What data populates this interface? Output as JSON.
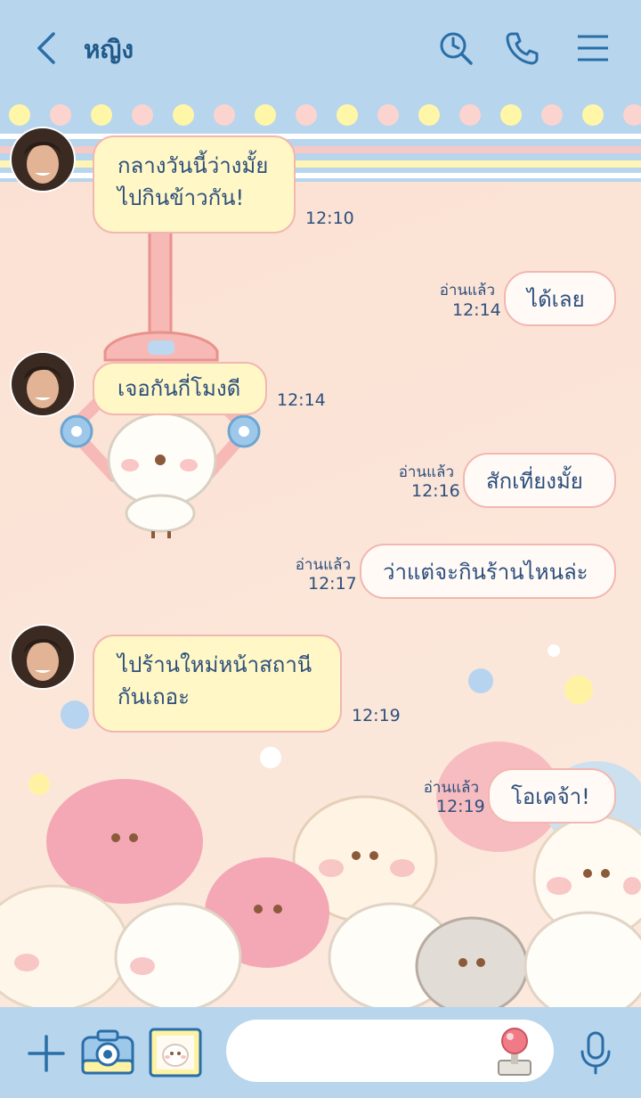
{
  "header": {
    "contact_name": "หญิง",
    "back_icon": "chevron-left-icon",
    "icons": [
      "clock-search-icon",
      "phone-icon",
      "menu-icon"
    ]
  },
  "messages": [
    {
      "dir": "in",
      "text_lines": [
        "กลางวันนี้ว่างมั้ย",
        "ไปกินข้าวกัน!"
      ],
      "time": "12:10"
    },
    {
      "dir": "out",
      "text": "ได้เลย",
      "read": "อ่านแล้ว",
      "time": "12:14"
    },
    {
      "dir": "in",
      "text_lines": [
        "เจอกันกี่โมงดี"
      ],
      "time": "12:14"
    },
    {
      "dir": "out",
      "text": "สักเที่ยงมั้ย",
      "read": "อ่านแล้ว",
      "time": "12:16"
    },
    {
      "dir": "out",
      "text": "ว่าแต่จะกินร้านไหนล่ะ",
      "read": "อ่านแล้ว",
      "time": "12:17"
    },
    {
      "dir": "in",
      "text_lines": [
        "ไปร้านใหม่หน้าสถานี",
        "กันเถอะ"
      ],
      "time": "12:19"
    },
    {
      "dir": "out",
      "text": "โอเคจ้า!",
      "read": "อ่านแล้ว",
      "time": "12:19"
    }
  ],
  "footer": {
    "icons": [
      "plus-icon",
      "camera-icon",
      "image-icon",
      "joystick-icon",
      "microphone-icon"
    ],
    "input_value": ""
  },
  "colors": {
    "header_bg": "#b7d5ec",
    "accent": "#2a6ea8",
    "chat_bg": "#fbe3d6",
    "incoming_bubble": "#fff7c6",
    "outgoing_bubble": "#fffaf6",
    "bubble_border": "#f2b7b0"
  }
}
